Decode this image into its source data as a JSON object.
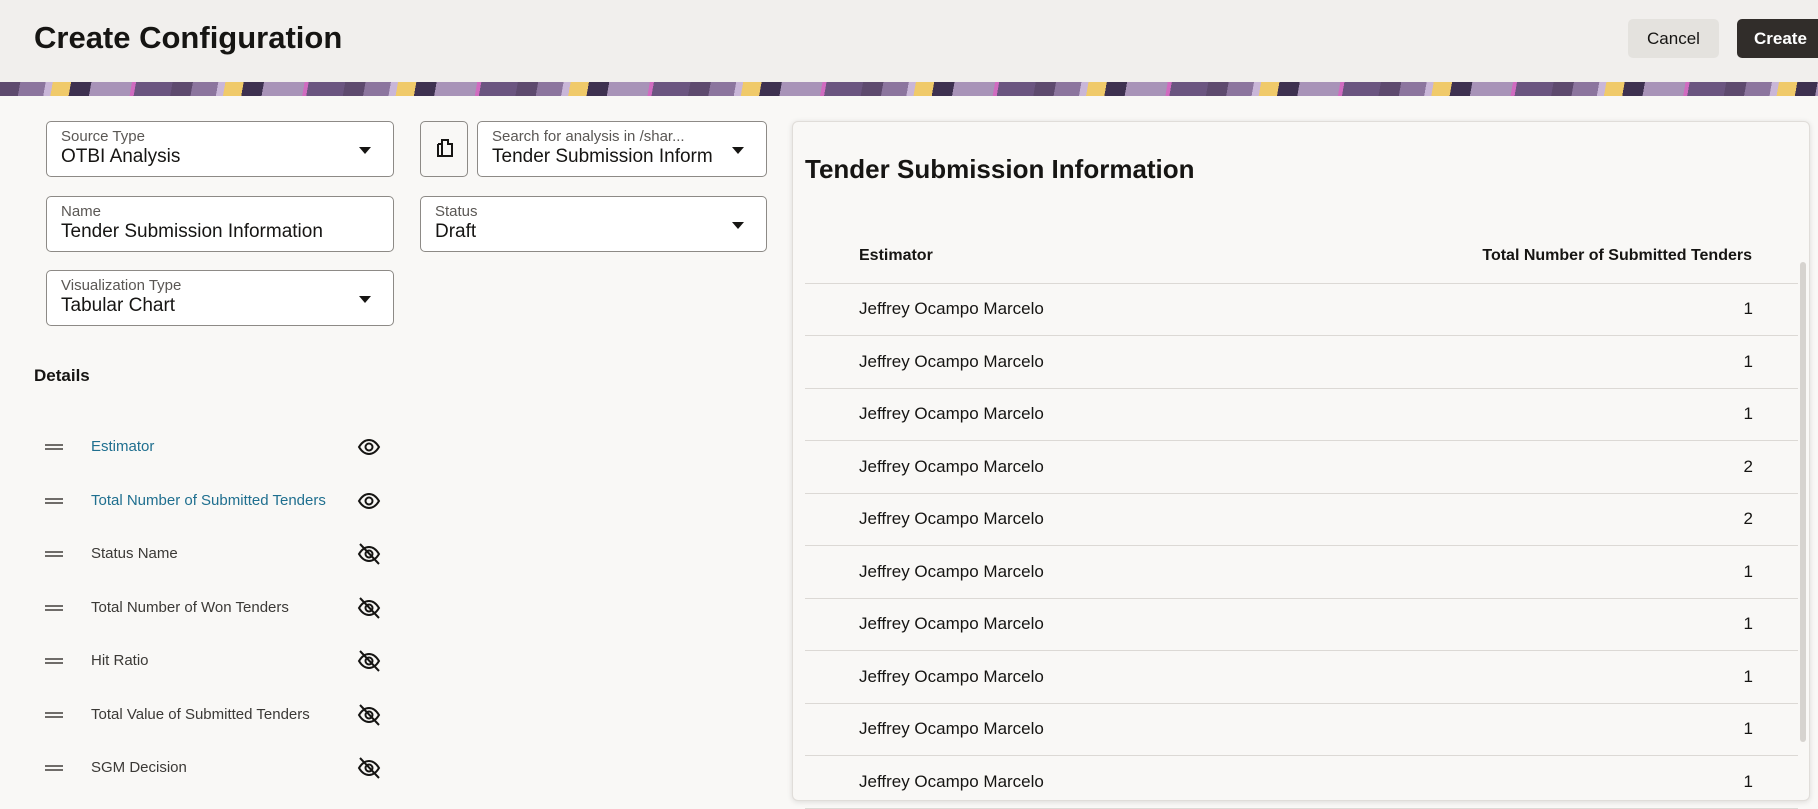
{
  "header": {
    "title": "Create Configuration",
    "cancel_label": "Cancel",
    "create_label": "Create"
  },
  "form": {
    "source_type": {
      "label": "Source Type",
      "value": "OTBI Analysis"
    },
    "search": {
      "label": "Search for analysis in /shar...",
      "value": "Tender Submission Inform"
    },
    "name": {
      "label": "Name",
      "value": "Tender Submission Information"
    },
    "status": {
      "label": "Status",
      "value": "Draft"
    },
    "visualization_type": {
      "label": "Visualization Type",
      "value": "Tabular Chart"
    }
  },
  "details": {
    "heading": "Details",
    "items": [
      {
        "label": "Estimator",
        "visible": true
      },
      {
        "label": "Total Number of Submitted Tenders",
        "visible": true
      },
      {
        "label": "Status Name",
        "visible": false
      },
      {
        "label": "Total Number of Won Tenders",
        "visible": false
      },
      {
        "label": "Hit Ratio",
        "visible": false
      },
      {
        "label": "Total Value of Submitted Tenders",
        "visible": false
      },
      {
        "label": "SGM Decision",
        "visible": false
      }
    ]
  },
  "preview": {
    "title": "Tender Submission Information",
    "columns": [
      "Estimator",
      "Total Number of Submitted Tenders"
    ],
    "rows": [
      [
        "Jeffrey Ocampo Marcelo",
        "1"
      ],
      [
        "Jeffrey Ocampo Marcelo",
        "1"
      ],
      [
        "Jeffrey Ocampo Marcelo",
        "1"
      ],
      [
        "Jeffrey Ocampo Marcelo",
        "2"
      ],
      [
        "Jeffrey Ocampo Marcelo",
        "2"
      ],
      [
        "Jeffrey Ocampo Marcelo",
        "1"
      ],
      [
        "Jeffrey Ocampo Marcelo",
        "1"
      ],
      [
        "Jeffrey Ocampo Marcelo",
        "1"
      ],
      [
        "Jeffrey Ocampo Marcelo",
        "1"
      ],
      [
        "Jeffrey Ocampo Marcelo",
        "1"
      ]
    ]
  },
  "colors": {
    "accent_link": "#1f6f8f",
    "primary_button": "#312d2a"
  }
}
